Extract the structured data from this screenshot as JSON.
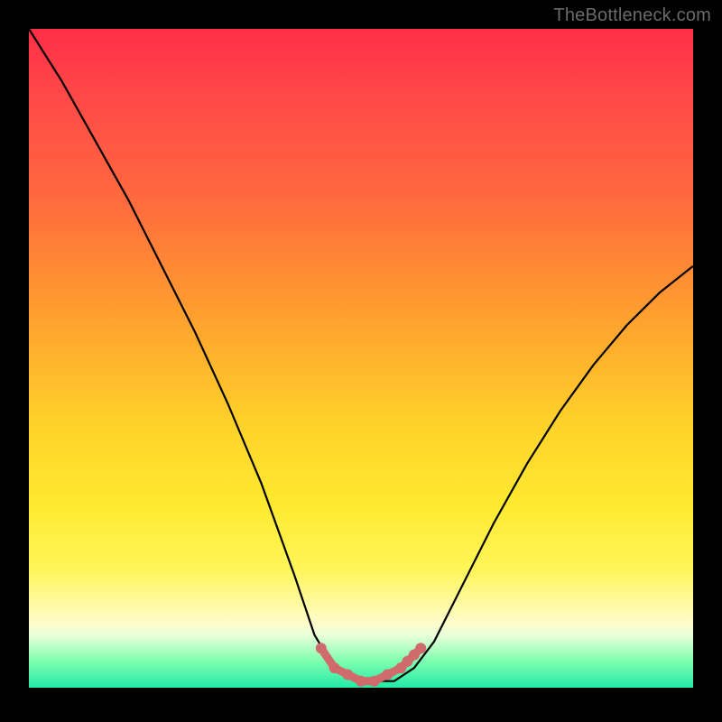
{
  "watermark": "TheBottleneck.com",
  "colors": {
    "frame": "#000000",
    "gradient_top": "#ff2e47",
    "gradient_mid": "#ffd22a",
    "gradient_bottom": "#22e9a6",
    "curve_stroke": "#000000",
    "marker_fill": "#d16a6a"
  },
  "chart_data": {
    "type": "line",
    "title": "",
    "xlabel": "",
    "ylabel": "",
    "xlim": [
      0,
      100
    ],
    "ylim": [
      0,
      100
    ],
    "series": [
      {
        "name": "bottleneck-curve",
        "x": [
          0,
          5,
          10,
          15,
          20,
          25,
          30,
          35,
          40,
          43,
          46,
          49,
          52,
          55,
          58,
          61,
          65,
          70,
          75,
          80,
          85,
          90,
          95,
          100
        ],
        "y": [
          100,
          92,
          83,
          74,
          64,
          54,
          43,
          31,
          17,
          8,
          3,
          1,
          1,
          1,
          3,
          7,
          15,
          25,
          34,
          42,
          49,
          55,
          60,
          64
        ]
      }
    ],
    "markers": {
      "name": "highlighted-points",
      "x": [
        44,
        46,
        48,
        50,
        52,
        54,
        56,
        57,
        58,
        59
      ],
      "y": [
        6,
        3,
        2,
        1,
        1,
        2,
        3,
        4,
        5,
        6
      ]
    }
  }
}
